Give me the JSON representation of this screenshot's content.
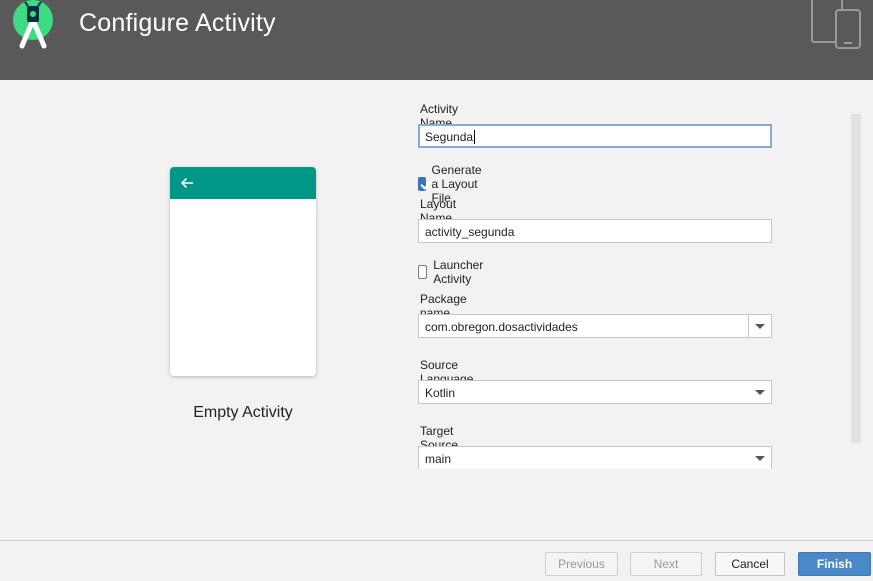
{
  "header": {
    "title": "Configure Activity"
  },
  "preview": {
    "template_name": "Empty Activity"
  },
  "form": {
    "activity_name": {
      "label": "Activity Name",
      "value": "Segunda"
    },
    "generate_layout": {
      "label": "Generate a Layout File",
      "checked": true
    },
    "layout_name": {
      "label": "Layout Name",
      "value": "activity_segunda"
    },
    "launcher_activity": {
      "label": "Launcher Activity",
      "checked": false
    },
    "package_name": {
      "label": "Package name",
      "value": "com.obregon.dosactividades"
    },
    "source_language": {
      "label": "Source Language",
      "value": "Kotlin"
    },
    "target_source_set": {
      "label": "Target Source Set",
      "value": "main"
    }
  },
  "footer": {
    "previous_label": "Previous",
    "next_label": "Next",
    "cancel_label": "Cancel",
    "finish_label": "Finish"
  },
  "colors": {
    "header_bg": "#595959",
    "appbar_teal": "#009688",
    "accent_blue": "#3b73b9",
    "logo_green": "#3ddc84"
  }
}
